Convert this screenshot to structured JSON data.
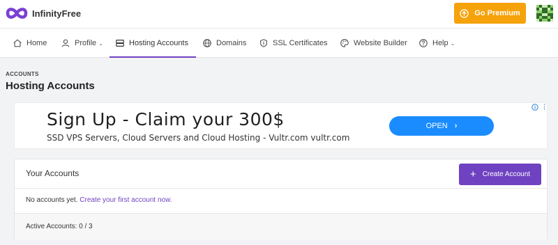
{
  "brand": {
    "name": "InfinityFree"
  },
  "header": {
    "premium_label": "Go Premium"
  },
  "nav": {
    "items": [
      {
        "label": "Home",
        "icon": "home-icon"
      },
      {
        "label": "Profile",
        "icon": "user-icon",
        "has_dropdown": true
      },
      {
        "label": "Hosting Accounts",
        "icon": "server-icon",
        "active": true
      },
      {
        "label": "Domains",
        "icon": "globe-icon"
      },
      {
        "label": "SSL Certificates",
        "icon": "shield-icon"
      },
      {
        "label": "Website Builder",
        "icon": "palette-icon"
      },
      {
        "label": "Help",
        "icon": "help-icon",
        "has_dropdown": true
      }
    ]
  },
  "page": {
    "breadcrumb": "ACCOUNTS",
    "title": "Hosting Accounts"
  },
  "ad": {
    "headline": "Sign Up - Claim your 300$",
    "description": "SSD VPS Servers, Cloud Servers and Cloud Hosting - Vultr.com vultr.com",
    "cta": "OPEN"
  },
  "accounts_card": {
    "title": "Your Accounts",
    "create_label": "Create Account",
    "empty_text": "No accounts yet.",
    "create_link": "Create your first account now.",
    "footer": "Active Accounts: 0 / 3"
  },
  "colors": {
    "accent": "#6f42c1",
    "premium": "#f6a20b",
    "ad_button": "#1a8cff"
  }
}
